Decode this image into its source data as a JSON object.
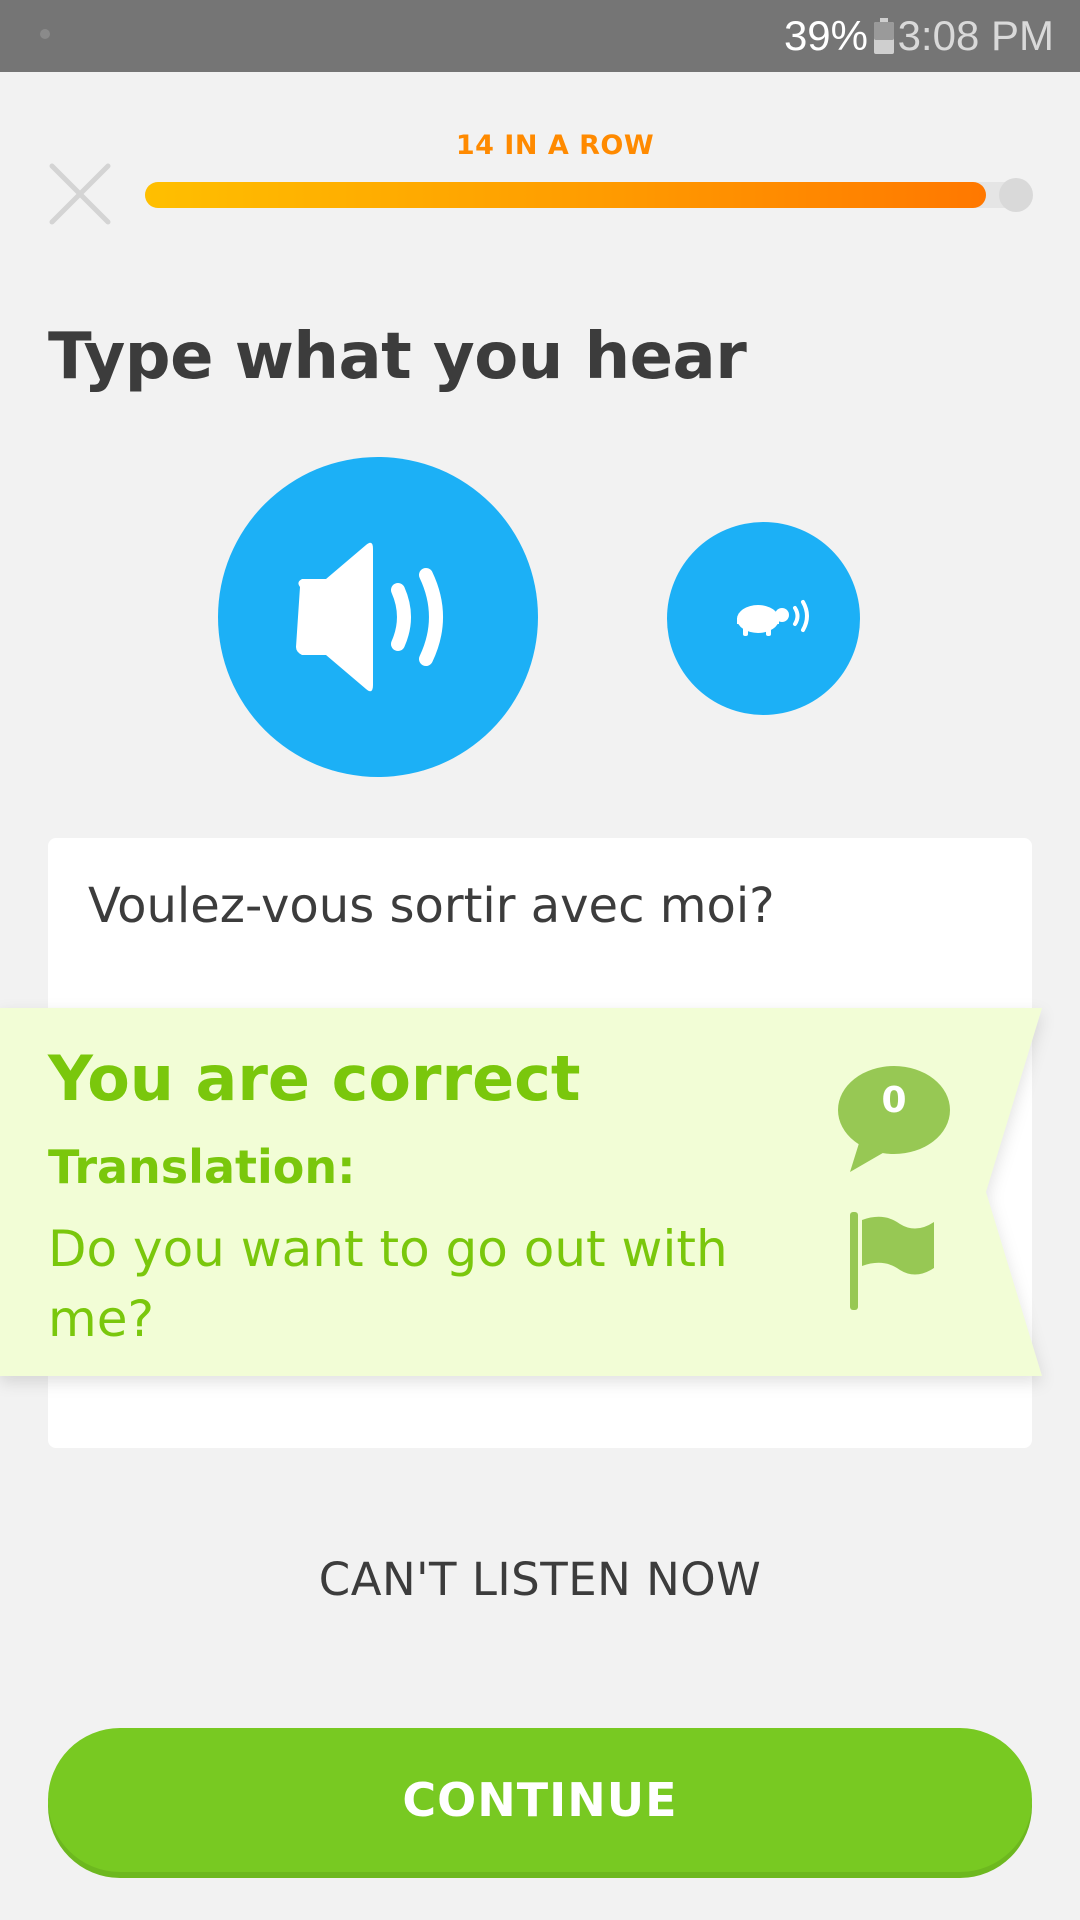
{
  "status_bar": {
    "battery_pct": "39%",
    "time": "3:08 PM",
    "battery_icon": "battery-icon"
  },
  "header": {
    "streak_label": "14 IN A ROW",
    "close_icon": "close-icon",
    "progress_fraction": 0.96,
    "colors": {
      "streak": "#ff8a00",
      "progress_start": "#ffbf00",
      "progress_end": "#ff7800"
    }
  },
  "prompt": {
    "title": "Type what you hear"
  },
  "audio": {
    "play_icon": "speaker-icon",
    "slow_icon": "turtle-icon",
    "button_color": "#1cb0f6"
  },
  "answer": {
    "value": "Voulez-vous sortir avec moi?"
  },
  "result": {
    "title": "You are correct",
    "translation_label": "Translation:",
    "translation_text": "Do you want to go out with me?",
    "comment_count": "0",
    "comment_icon": "speech-bubble-icon",
    "report_icon": "flag-icon",
    "colors": {
      "text": "#7ac70c",
      "background": "#f2fdd6"
    }
  },
  "footer": {
    "cant_listen_label": "CAN'T LISTEN NOW",
    "continue_label": "CONTINUE",
    "continue_color": "#78c922"
  }
}
